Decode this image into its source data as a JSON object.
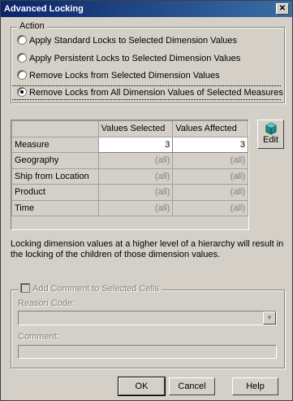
{
  "window": {
    "title": "Advanced Locking",
    "close_label": "✕"
  },
  "action_group": {
    "legend": "Action",
    "options": [
      {
        "label": "Apply Standard Locks to Selected Dimension Values",
        "selected": false
      },
      {
        "label": "Apply Persistent Locks to Selected Dimension Values",
        "selected": false
      },
      {
        "label": "Remove Locks from Selected Dimension Values",
        "selected": false
      },
      {
        "label": "Remove Locks from All Dimension Values of Selected Measures",
        "selected": true
      }
    ]
  },
  "grid": {
    "columns": [
      "",
      "Values Selected",
      "Values Affected"
    ],
    "rows": [
      {
        "label": "Measure",
        "selected": "3",
        "affected": "3"
      },
      {
        "label": "Geography",
        "selected": "(all)",
        "affected": "(all)"
      },
      {
        "label": "Ship from Location",
        "selected": "(all)",
        "affected": "(all)"
      },
      {
        "label": "Product",
        "selected": "(all)",
        "affected": "(all)"
      },
      {
        "label": "Time",
        "selected": "(all)",
        "affected": "(all)"
      }
    ]
  },
  "edit_button": {
    "label": "Edit",
    "icon": "edit-cube-icon",
    "icon_color": "#1a8c8c"
  },
  "info_text": "Locking dimension values at a higher level of a hierarchy will result in the locking of the children of those dimension values.",
  "comment_group": {
    "checkbox_label": "Add Comment to Selected Cells",
    "reason_label": "Reason Code:",
    "reason_value": "",
    "comment_label": "Comment:",
    "comment_value": ""
  },
  "buttons": {
    "ok": "OK",
    "cancel": "Cancel",
    "help": "Help"
  },
  "colors": {
    "titlebar_start": "#0a246a",
    "titlebar_end": "#3a6ea5",
    "dialog_bg": "#d4d0c8"
  }
}
